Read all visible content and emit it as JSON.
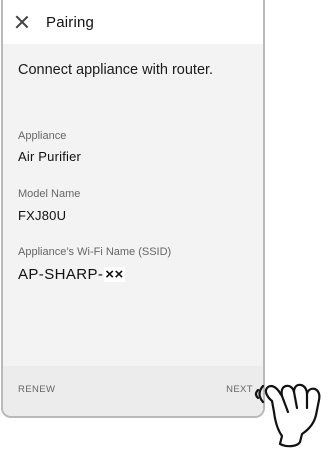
{
  "header": {
    "title": "Pairing",
    "close_icon": "close-icon"
  },
  "main": {
    "instruction": "Connect appliance with router.",
    "fields": [
      {
        "label": "Appliance",
        "value": "Air Purifier"
      },
      {
        "label": "Model Name",
        "value": "FXJ80U"
      },
      {
        "label": "Appliance’s Wi-Fi Name (SSID)",
        "value": "AP-SHARP-",
        "masked_suffix": "××"
      }
    ]
  },
  "footer": {
    "renew_label": "RENEW",
    "next_label": "NEXT"
  },
  "overlay": {
    "icon": "tapping-hand-icon"
  }
}
